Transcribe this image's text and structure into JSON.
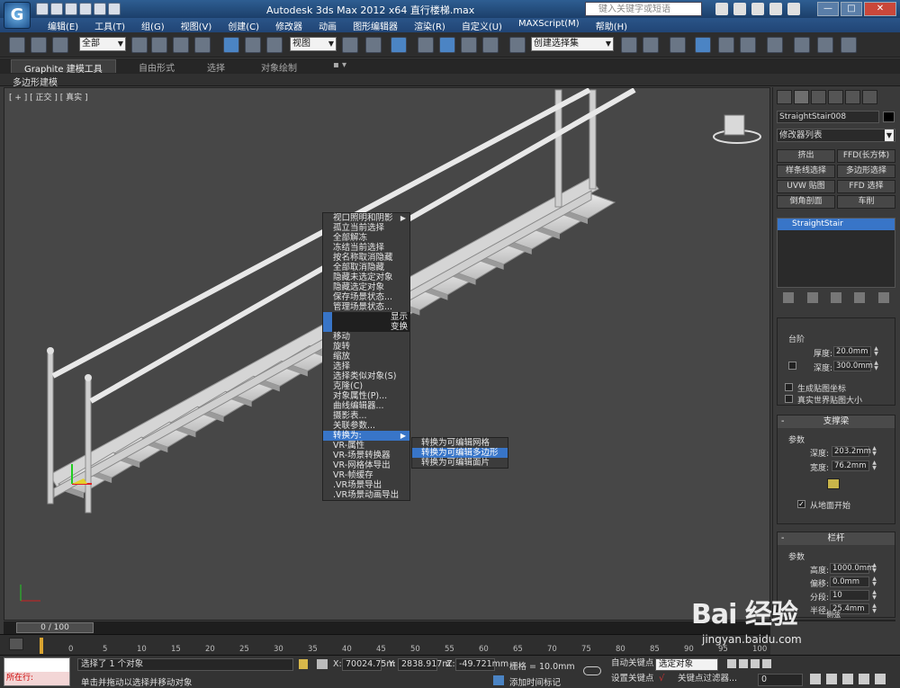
{
  "titlebar": {
    "title": "Autodesk 3ds Max  2012 x64     直行楼梯.max",
    "search_placeholder": "键入关键字或短语",
    "minimize": "—",
    "maximize": "□",
    "close": "✕"
  },
  "menu": [
    "编辑(E)",
    "工具(T)",
    "组(G)",
    "视图(V)",
    "创建(C)",
    "修改器",
    "动画",
    "图形编辑器",
    "渲染(R)",
    "自定义(U)",
    "MAXScript(M)",
    "帮助(H)"
  ],
  "toolbar": {
    "selection_filter": "全部",
    "reference_coord": "视图",
    "selection_set": "创建选择集"
  },
  "ribbon": {
    "tabs": [
      "Graphite 建模工具",
      "自由形式",
      "选择",
      "对象绘制"
    ],
    "panel_label": "多边形建模"
  },
  "viewport": {
    "label": "[ + ] [ 正交 ] [ 真实 ]"
  },
  "quad_menu": {
    "top_items": [
      {
        "label": "视口照明和阴影",
        "submenu": true
      },
      {
        "label": "孤立当前选择"
      },
      {
        "label": "全部解冻"
      },
      {
        "label": "冻结当前选择"
      },
      {
        "label": "按名称取消隐藏"
      },
      {
        "label": "全部取消隐藏"
      },
      {
        "label": "隐藏未选定对象"
      },
      {
        "label": "隐藏选定对象"
      },
      {
        "label": "保存场景状态..."
      },
      {
        "label": "管理场景状态..."
      }
    ],
    "quadrant_display": "显示",
    "quadrant_transform": "变换",
    "bottom_items": [
      {
        "label": "移动"
      },
      {
        "label": "旋转"
      },
      {
        "label": "缩放"
      },
      {
        "label": "选择"
      },
      {
        "label": "选择类似对象(S)"
      },
      {
        "label": "克隆(C)"
      },
      {
        "label": "对象属性(P)..."
      },
      {
        "label": "曲线编辑器..."
      },
      {
        "label": "摄影表..."
      },
      {
        "label": "关联参数..."
      },
      {
        "label": "转换为:",
        "submenu": true,
        "highlighted": true
      },
      {
        "label": "VR-属性"
      },
      {
        "label": "VR-场景转换器"
      },
      {
        "label": "VR-网格体导出"
      },
      {
        "label": "VR-帧缓存"
      },
      {
        "label": ".VR场景导出"
      },
      {
        "label": ".VR场景动画导出"
      }
    ],
    "convert_submenu": [
      "转换为可编辑网格",
      "转换为可编辑多边形",
      "转换为可编辑面片"
    ]
  },
  "command_panel": {
    "object_name": "StraightStair008",
    "modifier_list": "修改器列表",
    "modifier_buttons": [
      "挤出",
      "FFD(长方体)",
      "样条线选择",
      "多边形选择",
      "UVW 贴图",
      "FFD 选择",
      "倒角剖面",
      "车削"
    ],
    "stack_item": "StraightStair",
    "steps_group": "台阶",
    "thickness_label": "厚度:",
    "thickness_value": "20.0mm",
    "depth_label": "深度:",
    "depth_value": "300.0mm",
    "gen_map_coords": "生成贴图坐标",
    "real_world_map": "真实世界贴图大小",
    "stringers_title": "支撑梁",
    "params_label": "参数",
    "stringer_depth_label": "深度:",
    "stringer_depth_value": "203.2mm",
    "stringer_width_label": "宽度:",
    "stringer_width_value": "76.2mm",
    "from_floor": "从地面开始",
    "railings_title": "栏杆",
    "railing_params_label": "参数",
    "height_label": "高度:",
    "height_value": "1000.0mm",
    "offset_label": "偏移:",
    "offset_value": "0.0mm",
    "segments_label": "分段:",
    "segments_value": "10",
    "radius_label": "半径:",
    "radius_value": "25.4mm",
    "next_rollout": "侧弦"
  },
  "timeline": {
    "frame_display": "0 / 100",
    "ticks": [
      "0",
      "5",
      "10",
      "15",
      "20",
      "25",
      "30",
      "35",
      "40",
      "45",
      "50",
      "55",
      "60",
      "65",
      "70",
      "75",
      "80",
      "85",
      "90",
      "95",
      "100"
    ]
  },
  "status": {
    "maxscript_status": "所在行:",
    "selected_text": "选择了 1 个对象",
    "prompt_text": "单击并拖动以选择并移动对象",
    "x_label": "X:",
    "x_value": "70024.75m",
    "y_label": "Y:",
    "y_value": "2838.917m",
    "z_label": "Z:",
    "z_value": "-49.721mm",
    "grid": "栅格 = 10.0mm",
    "add_time_tag": "添加时间标记",
    "auto_key": "自动关键点",
    "set_key": "设置关键点",
    "selected_object": "选定对象",
    "key_filters": "关键点过滤器...",
    "frame_field": "0"
  },
  "watermark": {
    "brand": "Bai 经验",
    "url": "jingyan.baidu.com"
  }
}
